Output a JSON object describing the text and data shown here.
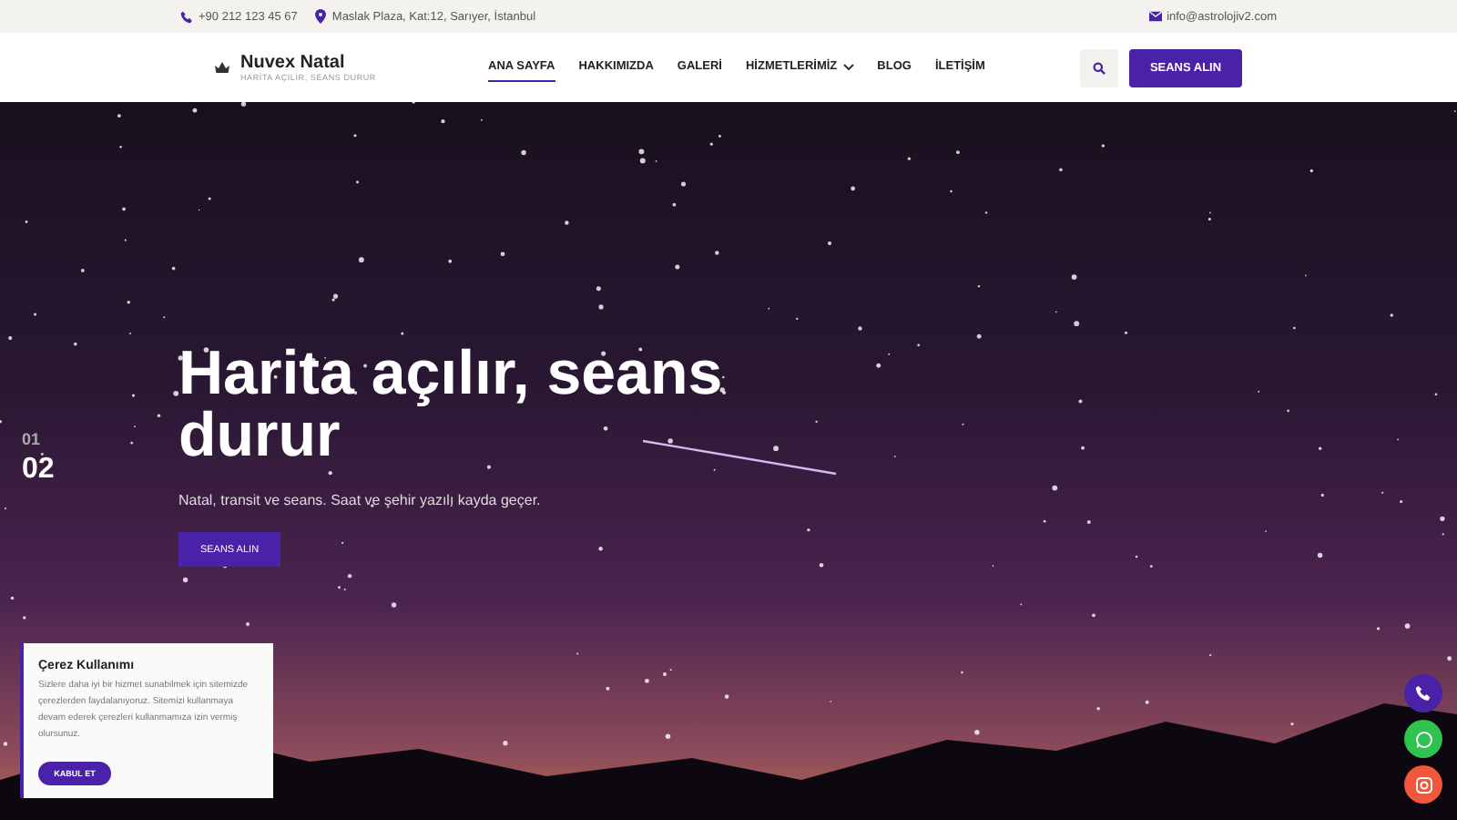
{
  "top_bar": {
    "phone": "+90 212 123 45 67",
    "address": "Maslak Plaza, Kat:12, Sarıyer, İstanbul",
    "email": "info@astrolojiv2.com"
  },
  "header": {
    "logo_title": "Nuvex Natal",
    "logo_tagline": "HARİTA AÇILIR, SEANS DURUR",
    "nav": [
      {
        "label": "ANA SAYFA",
        "selected": true,
        "dropdown": false
      },
      {
        "label": "HAKKIMIZDA",
        "selected": false,
        "dropdown": false
      },
      {
        "label": "GALERİ",
        "selected": false,
        "dropdown": false
      },
      {
        "label": "HİZMETLERİMİZ",
        "selected": false,
        "dropdown": true
      },
      {
        "label": "BLOG",
        "selected": false,
        "dropdown": false
      },
      {
        "label": "İLETİŞİM",
        "selected": false,
        "dropdown": false
      }
    ],
    "cta": "SEANS ALIN"
  },
  "hero": {
    "slides": [
      {
        "number": "01",
        "selected": false
      },
      {
        "number": "02",
        "selected": true
      }
    ],
    "title": "Harita açılır, seans durur",
    "subtitle": "Natal, transit ve seans. Saat ve şehir yazılı kayda geçer.",
    "button": "SEANS ALIN"
  },
  "cookie_notice": {
    "title": "Çerez Kullanımı",
    "text": "Sizlere daha iyi bir hizmet sunabilmek için sitemizde çerezlerden faydalanıyoruz. Sitemizi kullanmaya devam ederek çerezleri kullanmamıza izin vermiş olursunuz.",
    "button": "KABUL ET"
  },
  "floating_buttons": [
    {
      "kind": "phone",
      "color": "#4a22a8"
    },
    {
      "kind": "whatsapp",
      "color": "#2fc24f"
    },
    {
      "kind": "instagram",
      "color": "#f0573c"
    }
  ]
}
